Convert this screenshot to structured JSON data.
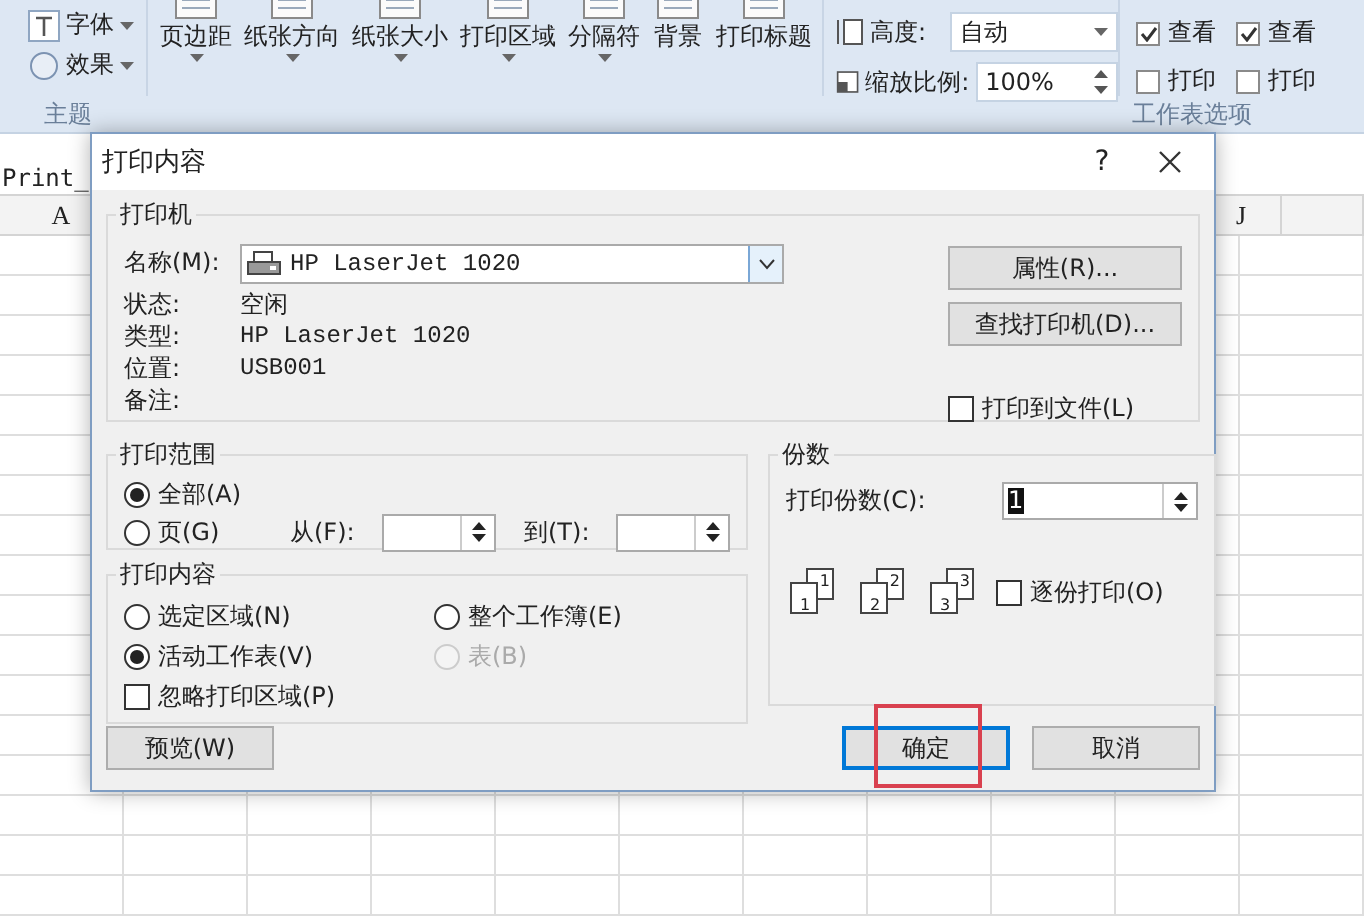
{
  "ribbon": {
    "theme_items": [
      {
        "label": "字体"
      },
      {
        "label": "效果"
      }
    ],
    "theme_group_label": "主题",
    "page_setup_buttons": [
      "页边距",
      "纸张方向",
      "纸张大小",
      "打印区域",
      "分隔符",
      "背景",
      "打印标题"
    ],
    "scale": {
      "height_label": "高度:",
      "height_value": "自动",
      "scale_label": "缩放比例:",
      "scale_value": "100%"
    },
    "sheet_options": [
      [
        {
          "label": "查看",
          "checked": true
        },
        {
          "label": "打印",
          "checked": false
        }
      ],
      [
        {
          "label": "查看",
          "checked": true
        },
        {
          "label": "打印",
          "checked": false
        }
      ]
    ],
    "sheet_options_group_label": "工作表选项"
  },
  "name_box": "Print_",
  "columns": [
    "A",
    "J"
  ],
  "dialog": {
    "title": "打印内容",
    "help": "?",
    "printer": {
      "group_label": "打印机",
      "name_label": "名称(M):",
      "name_value": "HP LaserJet 1020",
      "info": [
        {
          "label": "状态:",
          "value": "空闲"
        },
        {
          "label": "类型:",
          "value": "HP LaserJet 1020"
        },
        {
          "label": "位置:",
          "value": "USB001"
        },
        {
          "label": "备注:"
        }
      ],
      "buttons": [
        "属性(R)...",
        "查找打印机(D)..."
      ],
      "print_to_file": {
        "label": "打印到文件(L)",
        "checked": false
      }
    },
    "print_range": {
      "group_label": "打印范围",
      "options": [
        {
          "label": "全部(A)",
          "selected": true
        },
        {
          "label": "页(G)",
          "selected": false
        }
      ],
      "from_label": "从(F):",
      "to_label": "到(T):"
    },
    "print_content": {
      "group_label": "打印内容",
      "options": [
        {
          "label": "选定区域(N)",
          "selected": false,
          "disabled": false
        },
        {
          "label": "整个工作簿(E)",
          "selected": false,
          "disabled": false
        },
        {
          "label": "活动工作表(V)",
          "selected": true,
          "disabled": false
        },
        {
          "label": "表(B)",
          "selected": false,
          "disabled": true
        }
      ],
      "ignore_print_area": {
        "label": "忽略打印区域(P)",
        "checked": false
      }
    },
    "copies": {
      "group_label": "份数",
      "count_label": "打印份数(C):",
      "count_value": "1",
      "collate_icons": [
        {
          "back": "1",
          "front": "1"
        },
        {
          "back": "2",
          "front": "2"
        },
        {
          "back": "3",
          "front": "3"
        }
      ],
      "collate": {
        "label": "逐份打印(O)",
        "checked": false
      }
    },
    "buttons": [
      {
        "label": "预览(W)",
        "kind": "normal",
        "highlighted": false
      },
      {
        "label": "确定",
        "kind": "default",
        "highlighted": true
      },
      {
        "label": "取消",
        "kind": "normal",
        "highlighted": false
      }
    ]
  }
}
